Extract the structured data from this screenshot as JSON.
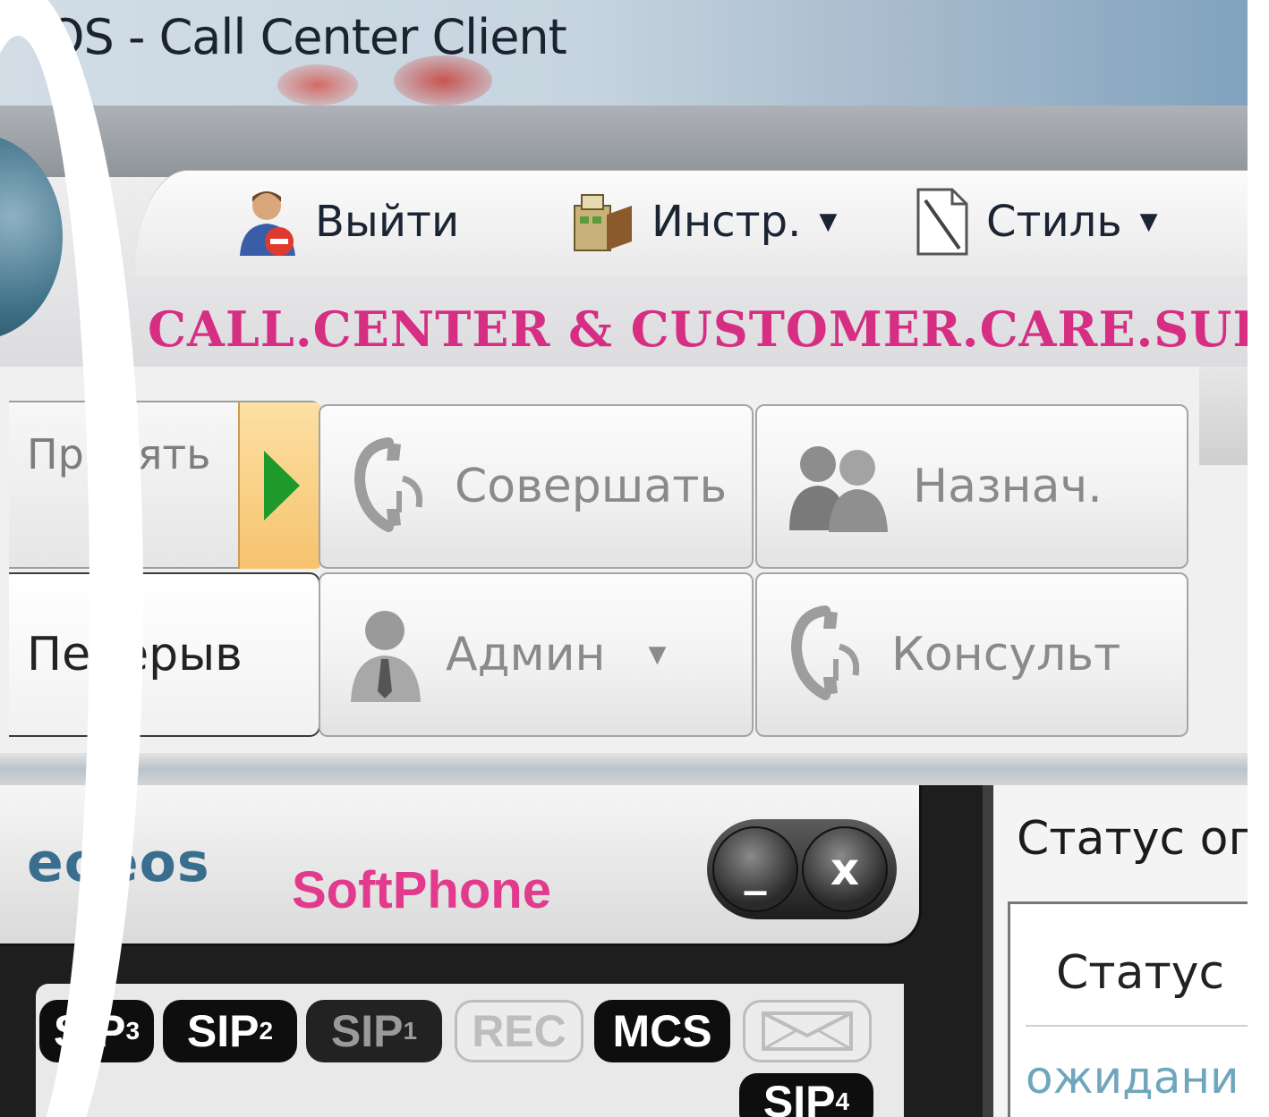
{
  "window": {
    "title": "OS - Call Center Client"
  },
  "quick_access": {
    "logout_label": "Выйти",
    "tools_label": "Инстр.",
    "style_label": "Стиль"
  },
  "brand_banner": "CALL.CENTER & CUSTOMER.CARE.SUIT",
  "actions": {
    "accept_label": "Принять",
    "break_label": "Перерыв",
    "make_call_label": "Совершать",
    "assign_label": "Назнач.",
    "admin_label": "Админ",
    "consult_label": "Консульт"
  },
  "softphone": {
    "logo_text": "eoeos",
    "title": "SoftPhone",
    "minimize_label": "_",
    "close_label": "x",
    "chips": [
      {
        "main": "SIP",
        "sub": "3"
      },
      {
        "main": "SIP",
        "sub": "2"
      },
      {
        "main": "SIP",
        "sub": "1"
      },
      {
        "main": "REC",
        "sub": ""
      },
      {
        "main": "MCS",
        "sub": ""
      },
      {
        "main": "SIP",
        "sub": "4"
      }
    ]
  },
  "status_panel": {
    "title": "Статус ог",
    "column_header": "Статус",
    "row_value": "ожидани"
  },
  "colors": {
    "brand_pink": "#d52e83",
    "softphone_pink": "#e23a8c",
    "play_green": "#1e9a2a",
    "accent_orange": "#f6c36e"
  }
}
